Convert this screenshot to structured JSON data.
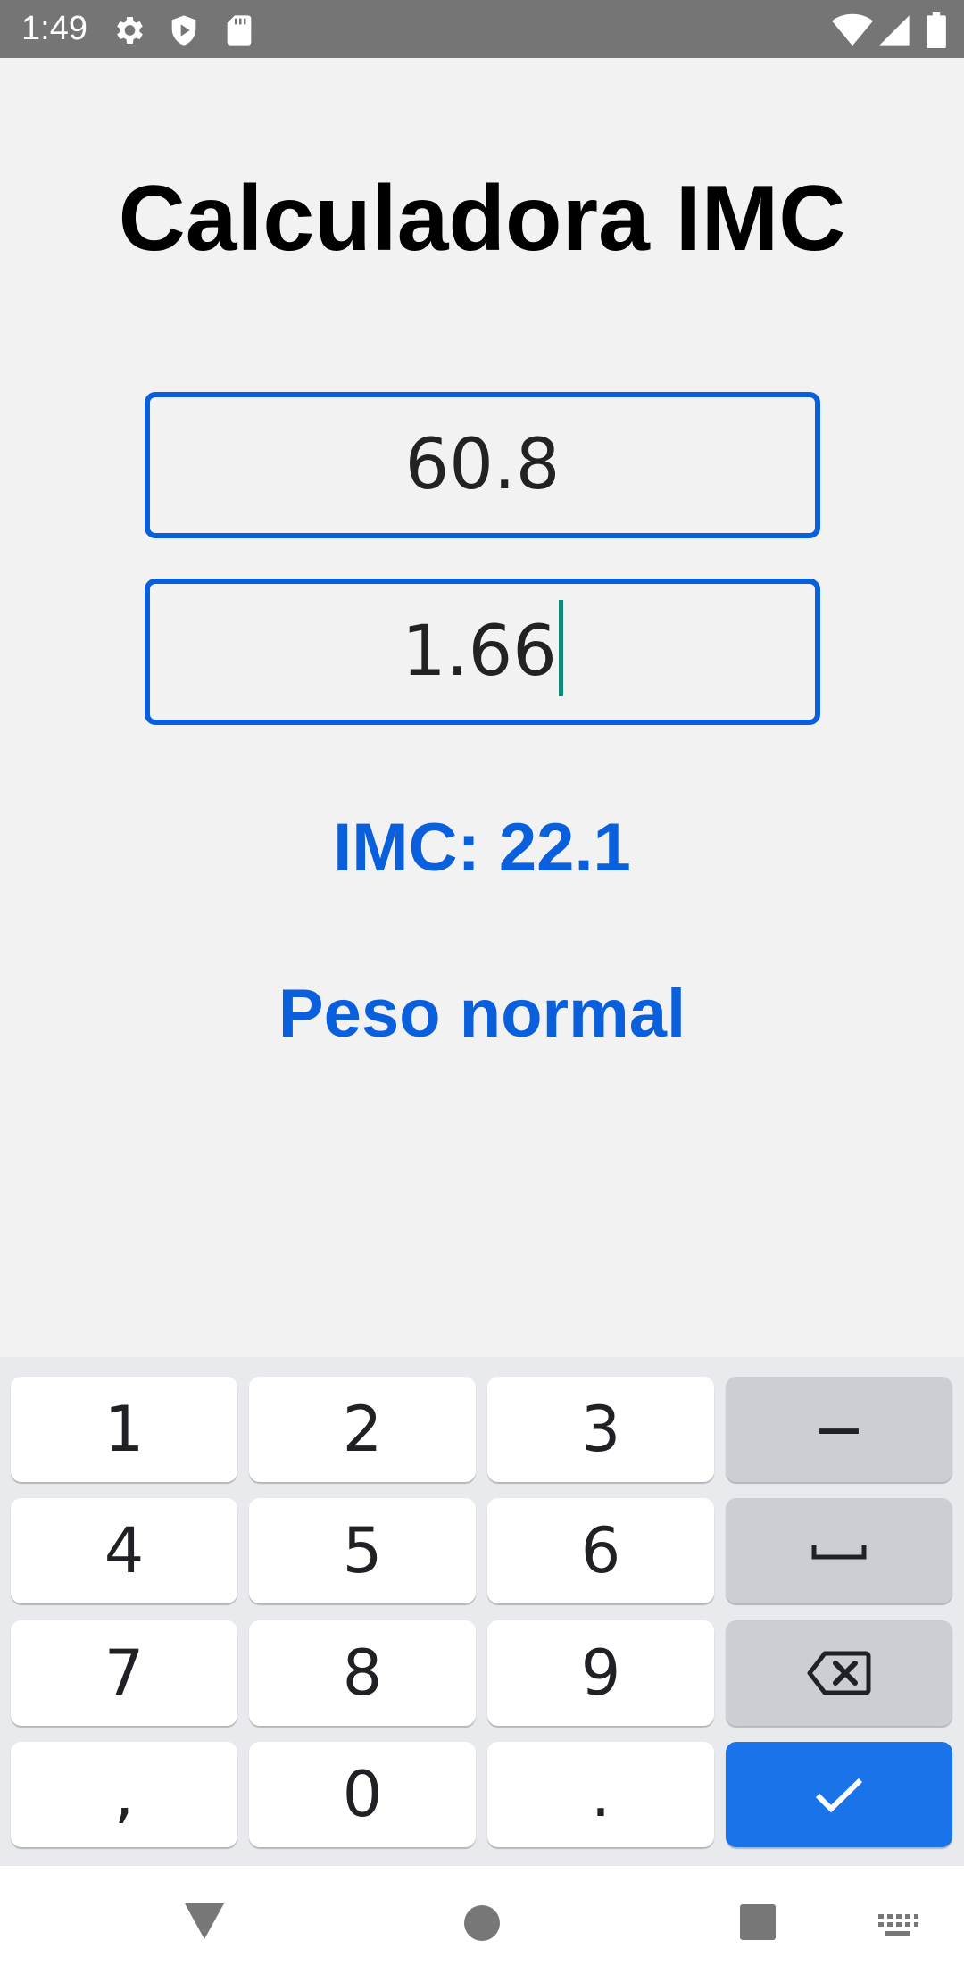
{
  "status_bar": {
    "time": "1:49",
    "icons": [
      "gear-icon",
      "shield-play-icon",
      "sd-card-icon",
      "wifi-icon",
      "signal-icon",
      "battery-icon"
    ]
  },
  "app": {
    "title": "Calculadora IMC",
    "weight_value": "60.8",
    "height_value": "1.66",
    "imc_result": "IMC: 22.1",
    "classification": "Peso normal",
    "accent_color": "#0a60dc"
  },
  "keyboard": {
    "keys": [
      "1",
      "2",
      "3",
      "−",
      "4",
      "5",
      "6",
      "space-icon",
      "7",
      "8",
      "9",
      "backspace-icon",
      ",",
      "0",
      ".",
      "check-icon"
    ],
    "done_color": "#1a73e8"
  },
  "nav_bar": {
    "icons": [
      "back-triangle-icon",
      "home-circle-icon",
      "recents-square-icon",
      "keyboard-switch-icon"
    ]
  }
}
